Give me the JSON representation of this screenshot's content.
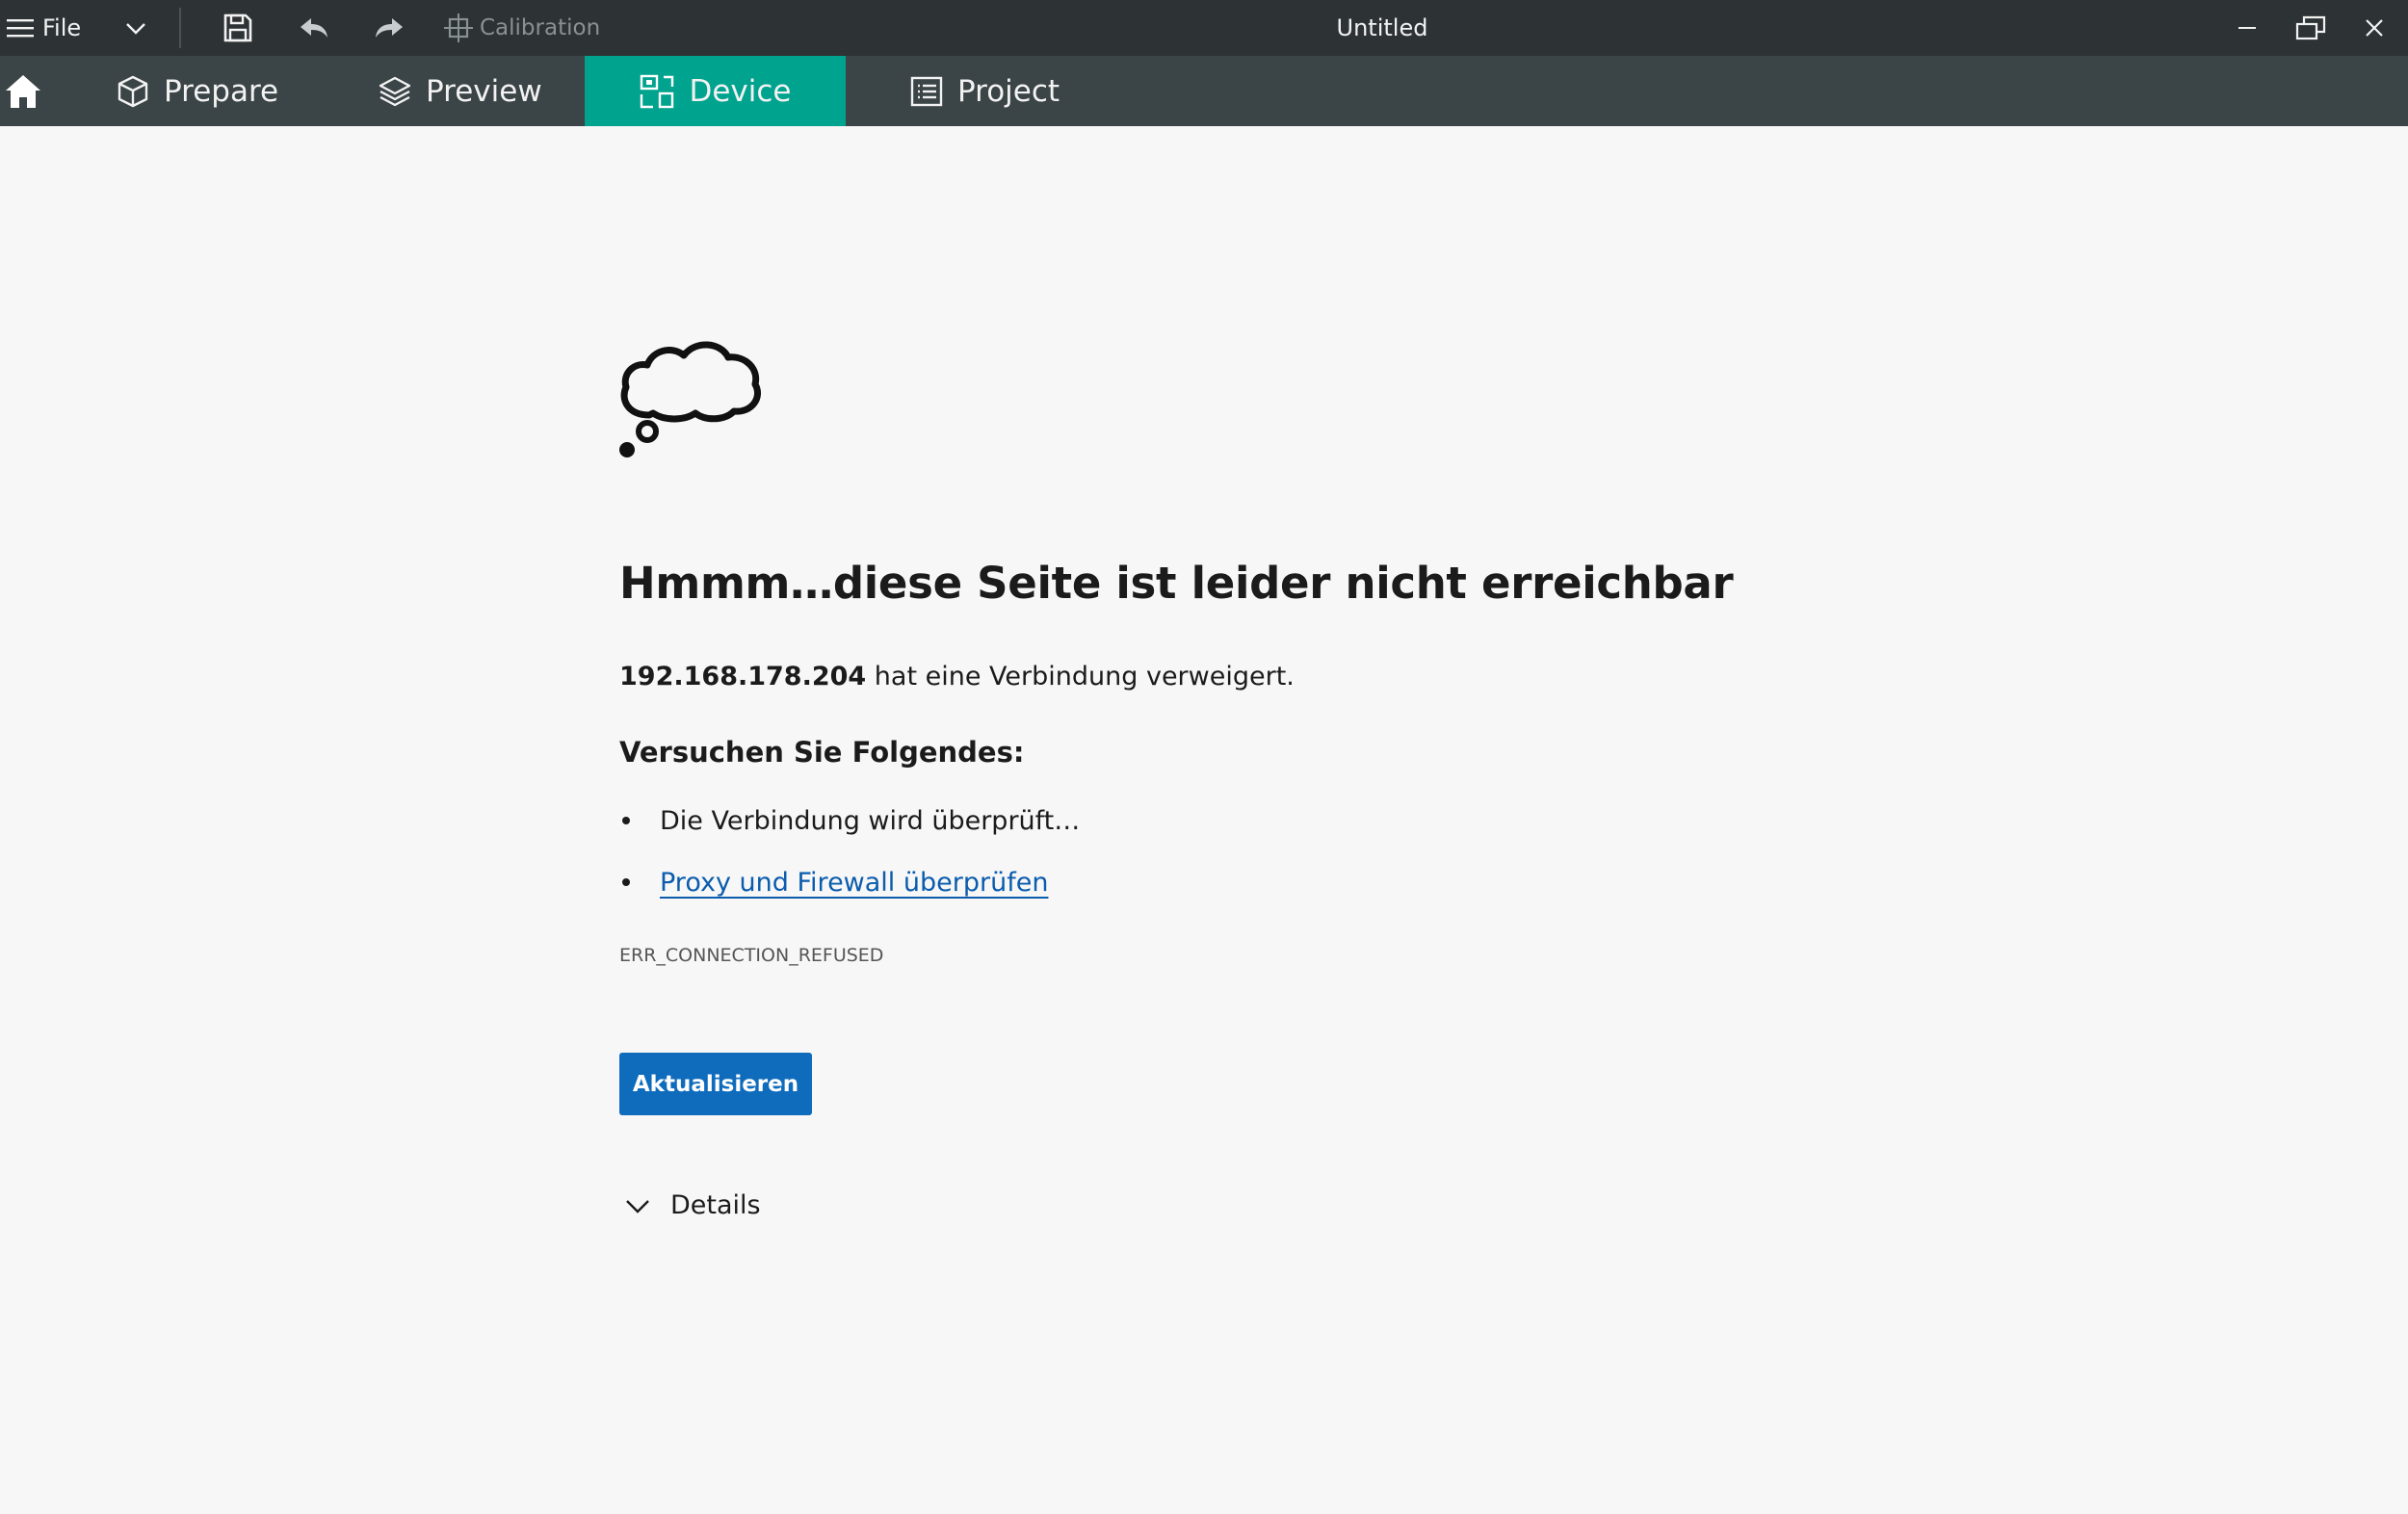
{
  "titlebar": {
    "file_label": "File",
    "calibration_label": "Calibration",
    "window_title": "Untitled"
  },
  "tabs": [
    {
      "label": "Prepare",
      "icon": "cube-icon",
      "active": false
    },
    {
      "label": "Preview",
      "icon": "layers-icon",
      "active": false
    },
    {
      "label": "Device",
      "icon": "device-icon",
      "active": true
    },
    {
      "label": "Project",
      "icon": "list-icon",
      "active": false
    }
  ],
  "colors": {
    "titlebar_bg": "#2d3335",
    "tabbar_bg": "#3b4446",
    "active_tab": "#00a38e",
    "button_blue": "#0f6cbd",
    "link_blue": "#0b5cad"
  },
  "error_page": {
    "icon": "thought-cloud-icon",
    "title": "Hmmm…diese Seite ist leider nicht erreichbar",
    "host": "192.168.178.204",
    "description_suffix": " hat eine Verbindung verweigert.",
    "try_heading": "Versuchen Sie Folgendes:",
    "bullets": [
      {
        "text": "Die Verbindung wird überprüft…",
        "is_link": false
      },
      {
        "text": "Proxy und Firewall überprüfen",
        "is_link": true
      }
    ],
    "error_code": "ERR_CONNECTION_REFUSED",
    "refresh_label": "Aktualisieren",
    "details_label": "Details"
  }
}
